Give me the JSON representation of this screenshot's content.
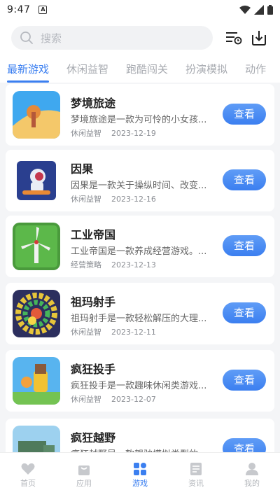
{
  "status_bar": {
    "time": "9:47",
    "notif_letter": "A"
  },
  "search": {
    "placeholder": "搜索"
  },
  "tabs": [
    {
      "label": "最新游戏",
      "active": true
    },
    {
      "label": "休闲益智"
    },
    {
      "label": "跑酷闯关"
    },
    {
      "label": "扮演模拟"
    },
    {
      "label": "动作"
    }
  ],
  "games": [
    {
      "title": "梦境旅途",
      "desc": "梦境旅途是一款为可怜的小女孩...",
      "category": "休闲益智",
      "date": "2023-12-19",
      "button": "查看",
      "icon": "dream-journey-icon"
    },
    {
      "title": "因果",
      "desc": "因果是一款关于操纵时间、改变...",
      "category": "休闲益智",
      "date": "2023-12-16",
      "button": "查看",
      "icon": "astronaut-icon"
    },
    {
      "title": "工业帝国",
      "desc": "工业帝国是一款养成经营游戏。...",
      "category": "经营策略",
      "date": "2023-12-13",
      "button": "查看",
      "icon": "windmill-icon"
    },
    {
      "title": "祖玛射手",
      "desc": "祖玛射手是一款轻松解压的大理...",
      "category": "休闲益智",
      "date": "2023-12-11",
      "button": "查看",
      "icon": "zuma-balls-icon"
    },
    {
      "title": "疯狂投手",
      "desc": "疯狂投手是一款趣味休闲类游戏...",
      "category": "休闲益智",
      "date": "2023-12-07",
      "button": "查看",
      "icon": "pitcher-icon"
    },
    {
      "title": "疯狂越野",
      "desc": "疯狂越野是一款驾驶模拟类型的...",
      "category": "",
      "date": "",
      "button": "查看",
      "icon": "truck-icon"
    }
  ],
  "bottom_nav": [
    {
      "label": "首页",
      "icon": "heart-icon"
    },
    {
      "label": "应用",
      "icon": "bag-icon"
    },
    {
      "label": "游戏",
      "icon": "grid-icon",
      "active": true
    },
    {
      "label": "资讯",
      "icon": "news-icon"
    },
    {
      "label": "我的",
      "icon": "user-icon"
    }
  ],
  "colors": {
    "accent": "#3b7ff0",
    "inactive": "#b4b7bc"
  }
}
